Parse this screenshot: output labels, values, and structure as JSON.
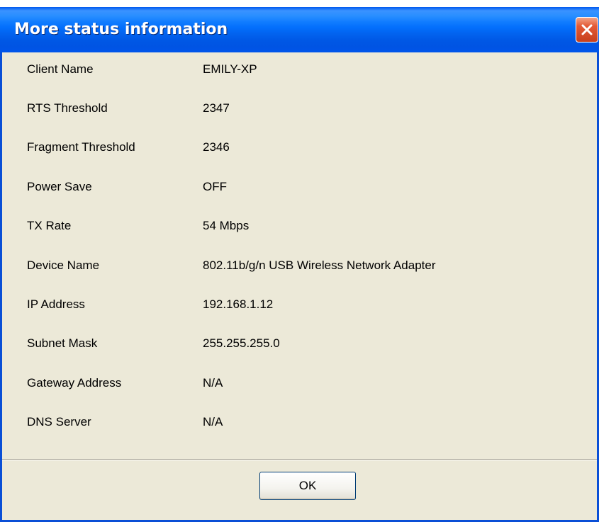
{
  "window": {
    "title": "More status information",
    "close_icon": "close-x-icon"
  },
  "rows": [
    {
      "label": "Client Name",
      "value": "EMILY-XP"
    },
    {
      "label": "RTS Threshold",
      "value": "2347"
    },
    {
      "label": "Fragment Threshold",
      "value": "2346"
    },
    {
      "label": "Power Save",
      "value": "OFF"
    },
    {
      "label": "TX Rate",
      "value": "54 Mbps"
    },
    {
      "label": "Device Name",
      "value": "802.11b/g/n USB Wireless Network Adapter"
    },
    {
      "label": "IP Address",
      "value": "192.168.1.12"
    },
    {
      "label": "Subnet Mask",
      "value": "255.255.255.0"
    },
    {
      "label": "Gateway Address",
      "value": "N/A"
    },
    {
      "label": "DNS Server",
      "value": "N/A"
    }
  ],
  "buttons": {
    "ok_label": "OK"
  },
  "colors": {
    "titlebar": "#0054e3",
    "dialog_background": "#ece9d8",
    "close_button": "#e35a36"
  }
}
